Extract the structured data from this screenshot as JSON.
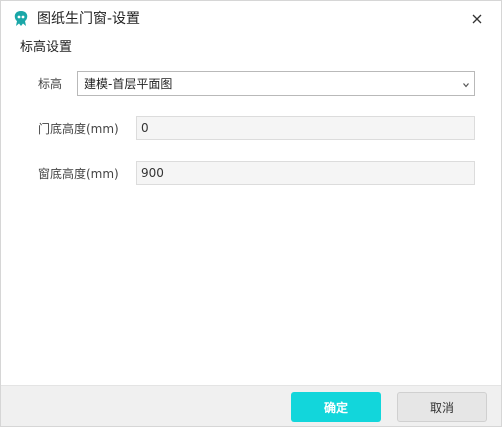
{
  "window": {
    "title": "图纸生门窗-设置",
    "app_icon": "app-logo-icon",
    "close_icon": "close-icon"
  },
  "section": {
    "title": "标高设置"
  },
  "form": {
    "elevation": {
      "label": "标高",
      "selected": "建模-首层平面图"
    },
    "door_sill": {
      "label": "门底高度(mm)",
      "value": "0"
    },
    "window_sill": {
      "label": "窗底高度(mm)",
      "value": "900"
    }
  },
  "footer": {
    "ok_label": "确定",
    "cancel_label": "取消"
  },
  "colors": {
    "accent": "#12d6db",
    "footer_bg": "#f0f0f0"
  }
}
